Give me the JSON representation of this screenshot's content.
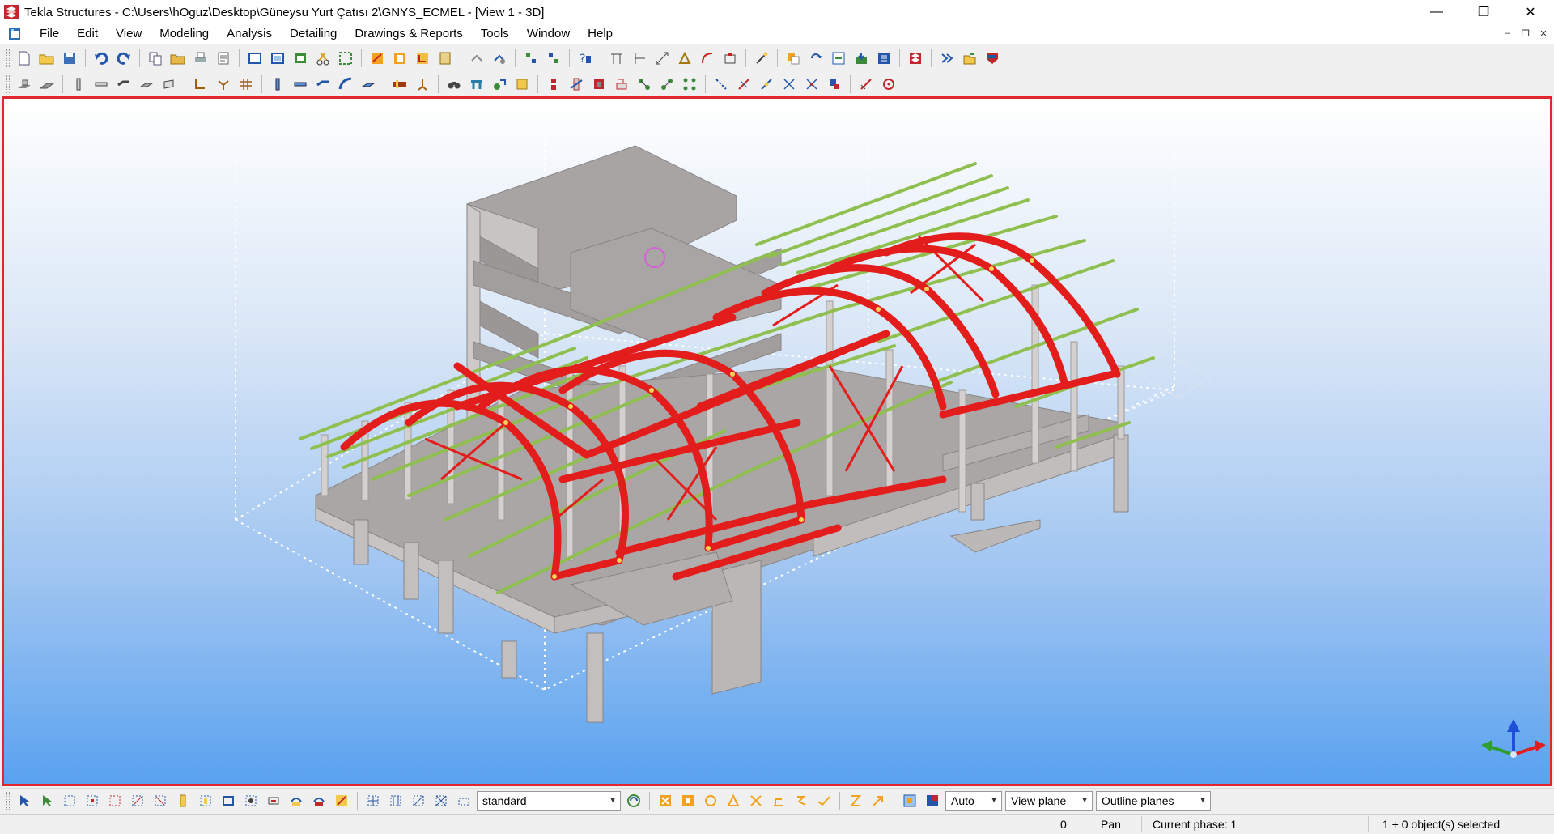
{
  "window": {
    "title": "Tekla Structures - C:\\Users\\hOguz\\Desktop\\Güneysu Yurt Çatısı 2\\GNYS_ECMEL  - [View 1 - 3D]",
    "minimize": "—",
    "restore": "❐",
    "close": "✕"
  },
  "menu": {
    "items": [
      {
        "label": "File"
      },
      {
        "label": "Edit"
      },
      {
        "label": "View"
      },
      {
        "label": "Modeling"
      },
      {
        "label": "Analysis"
      },
      {
        "label": "Detailing"
      },
      {
        "label": "Drawings & Reports"
      },
      {
        "label": "Tools"
      },
      {
        "label": "Window"
      },
      {
        "label": "Help"
      }
    ],
    "mdi_minimize": "–",
    "mdi_restore": "❐",
    "mdi_close": "✕"
  },
  "bottom_toolbar": {
    "filter_value": "standard",
    "snap_mode_value": "Auto",
    "plane_value": "View plane",
    "outline_value": "Outline planes"
  },
  "status": {
    "coord": "0",
    "mode": "Pan",
    "phase": "Current phase: 1",
    "selection": "1 + 0 object(s) selected"
  },
  "viewport": {
    "view_name": "View 1 - 3D",
    "border_color": "#e3262b",
    "steel_color": "#e31c1c",
    "purlin_color": "#8fbf4f",
    "concrete_color": "#b8b3b3"
  }
}
